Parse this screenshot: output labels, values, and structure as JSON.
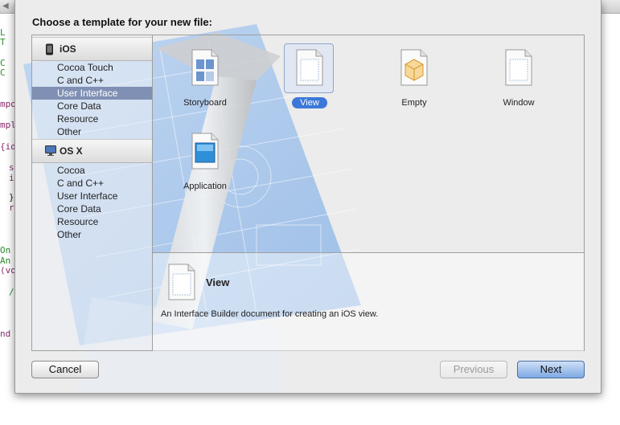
{
  "editor_fragments": [
    {
      "text": "L",
      "color": "#2c8a2c"
    },
    {
      "text": "T",
      "color": "#2c8a2c"
    },
    {
      "text": "C",
      "color": "#2c8a2c"
    },
    {
      "text": "C",
      "color": "#2c8a2c"
    },
    {
      "text": "mpo",
      "color": "#8a2c6e"
    },
    {
      "text": "mpl",
      "color": "#8a2c6e"
    },
    {
      "text": "{id",
      "color": "#8a2c6e"
    },
    {
      "text": "s",
      "color": "#8a2c6e"
    },
    {
      "text": "i",
      "color": "#8a2c6e"
    },
    {
      "text": "}",
      "color": "#222222"
    },
    {
      "text": "r",
      "color": "#8a2c6e"
    },
    {
      "text": "On",
      "color": "#2c8a2c"
    },
    {
      "text": "An",
      "color": "#2c8a2c"
    },
    {
      "text": "(vo",
      "color": "#8a2c6e"
    },
    {
      "text": "/",
      "color": "#2c8a2c"
    },
    {
      "text": "nd",
      "color": "#8a2c6e"
    }
  ],
  "dialog": {
    "title": "Choose a template for your new file:"
  },
  "sidebar": {
    "groups": [
      {
        "label": "iOS",
        "icon": "ios-device-icon",
        "items": [
          "Cocoa Touch",
          "C and C++",
          "User Interface",
          "Core Data",
          "Resource",
          "Other"
        ],
        "selected_index": 2
      },
      {
        "label": "OS X",
        "icon": "os-x-icon",
        "items": [
          "Cocoa",
          "C and C++",
          "User Interface",
          "Core Data",
          "Resource",
          "Other"
        ],
        "selected_index": -1
      }
    ]
  },
  "templates": [
    {
      "label": "Storyboard",
      "icon": "storyboard-icon",
      "selected": false
    },
    {
      "label": "View",
      "icon": "view-file-icon",
      "selected": true
    },
    {
      "label": "Empty",
      "icon": "empty-cube-icon",
      "selected": false
    },
    {
      "label": "Window",
      "icon": "window-file-icon",
      "selected": false
    },
    {
      "label": "Application",
      "icon": "application-file-icon",
      "selected": false
    }
  ],
  "detail": {
    "title": "View",
    "description": "An Interface Builder document for creating an iOS view."
  },
  "buttons": {
    "cancel": "Cancel",
    "previous": "Previous",
    "next": "Next"
  },
  "colors": {
    "selection_blue": "#3b78d9",
    "sidebar_selection": "#8090b4",
    "blueprint": "#9fc2ec"
  }
}
